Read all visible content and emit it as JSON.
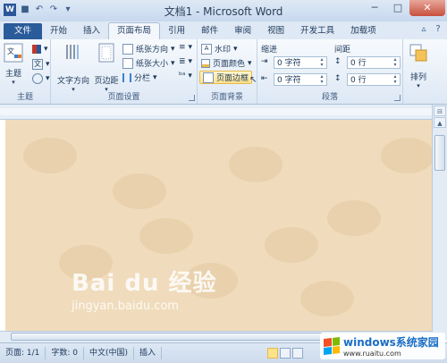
{
  "window": {
    "title": "文档1 - Microsoft Word"
  },
  "tabs": [
    {
      "label": "文件"
    },
    {
      "label": "开始"
    },
    {
      "label": "插入"
    },
    {
      "label": "页面布局"
    },
    {
      "label": "引用"
    },
    {
      "label": "邮件"
    },
    {
      "label": "审阅"
    },
    {
      "label": "视图"
    },
    {
      "label": "开发工具"
    },
    {
      "label": "加载项"
    }
  ],
  "ribbon": {
    "theme": {
      "label": "主题",
      "btn": "主题"
    },
    "page_setup": {
      "label": "页面设置",
      "text_direction": "文字方向",
      "margins": "页边距",
      "orientation": "纸张方向",
      "size": "纸张大小",
      "columns": "分栏"
    },
    "background": {
      "label": "页面背景",
      "watermark": "水印",
      "page_color": "页面颜色",
      "page_borders": "页面边框"
    },
    "paragraph": {
      "label": "段落",
      "indent_title": "缩进",
      "spacing_title": "间距",
      "indent_left": "0 字符",
      "indent_right": "0 字符",
      "space_before": "0 行",
      "space_after": "0 行"
    },
    "arrange": {
      "label": "排列"
    }
  },
  "status": {
    "page": "页面: 1/1",
    "words": "字数: 0",
    "lang": "中文(中国)",
    "mode": "插入"
  },
  "watermark": {
    "line1": "Bai du 经验",
    "line2": "jingyan.baidu.com"
  },
  "badge": {
    "title": "windows系统家园",
    "url": "www.ruaitu.com"
  }
}
